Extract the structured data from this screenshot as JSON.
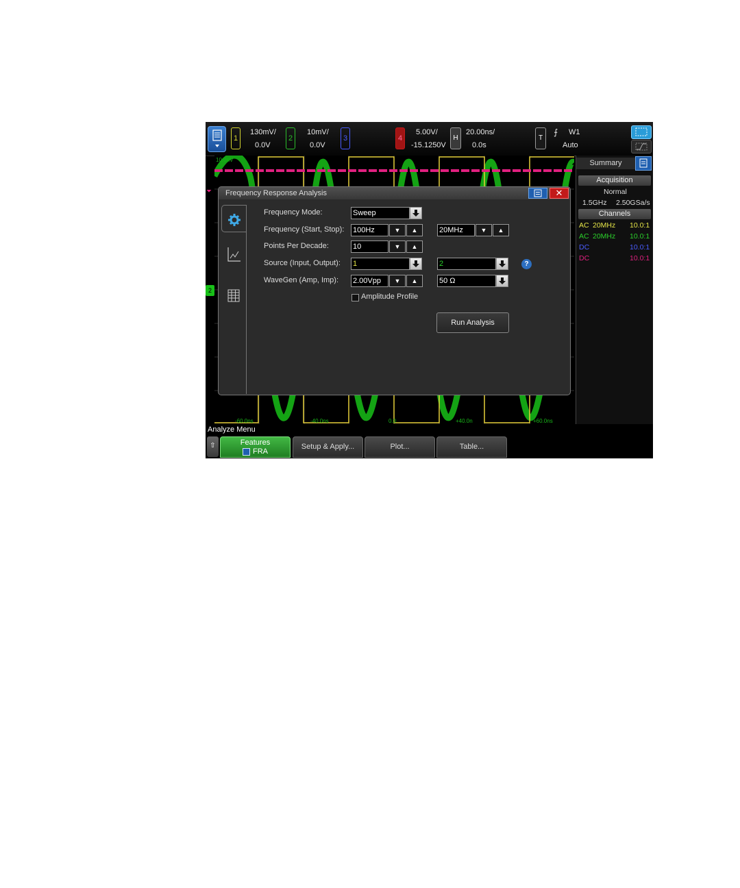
{
  "topbar": {
    "ch1": {
      "label": "1",
      "scale": "130mV/",
      "offset": "0.0V",
      "color": "#d6d630"
    },
    "ch2": {
      "label": "2",
      "scale": "10mV/",
      "offset": "0.0V",
      "color": "#2bbf2b"
    },
    "ch3": {
      "label": "3",
      "color": "#4a5cff"
    },
    "ch4": {
      "label": "4",
      "scale": "5.00V/",
      "offset": "-15.1250V",
      "color": "#e0207f"
    },
    "horizontal": {
      "label": "H",
      "timebase": "20.00ns/",
      "delay": "0.0s"
    },
    "trigger": {
      "label": "T",
      "slope_symbol": "⨍",
      "source": "W1",
      "mode": "Auto"
    }
  },
  "waveform": {
    "scale_label": "10.0nV",
    "time_labels": [
      "-60.0ns",
      "-40.0ns",
      "0.0",
      "+40.0n",
      "+60.0ns"
    ],
    "colors": {
      "yellow": "#e5cf3a",
      "green": "#18c018",
      "magenta": "#e0207f"
    },
    "ground_marker": "2"
  },
  "sidebar": {
    "title": "Summary",
    "acquisition": {
      "header": "Acquisition",
      "mode": "Normal",
      "bandwidth": "1.5GHz",
      "sample_rate": "2.50GSa/s"
    },
    "channels": {
      "header": "Channels",
      "rows": [
        {
          "coupling": "AC",
          "bw": "20MHz",
          "probe": "10.0:1",
          "color": "#e5e548"
        },
        {
          "coupling": "AC",
          "bw": "20MHz",
          "probe": "10.0:1",
          "color": "#2bd02b"
        },
        {
          "coupling": "DC",
          "bw": "",
          "probe": "10.0:1",
          "color": "#4a5cff"
        },
        {
          "coupling": "DC",
          "bw": "",
          "probe": "10.0:1",
          "color": "#e0207f"
        }
      ]
    }
  },
  "dialog": {
    "title": "Frequency Response Analysis",
    "close_symbol": "✕",
    "frequency_mode": {
      "label": "Frequency Mode:",
      "value": "Sweep"
    },
    "frequency": {
      "label": "Frequency (Start, Stop):",
      "start": "100Hz",
      "stop": "20MHz"
    },
    "points": {
      "label": "Points Per Decade:",
      "value": "10"
    },
    "source": {
      "label": "Source (Input, Output):",
      "input": "1",
      "output": "2",
      "input_color": "#e5e548",
      "output_color": "#2bd02b"
    },
    "wavegen": {
      "label": "WaveGen (Amp, Imp):",
      "amplitude": "2.00Vpp",
      "impedance": "50 Ω"
    },
    "amplitude_profile": {
      "label": "Amplitude Profile",
      "checked": false
    },
    "help_symbol": "?",
    "run_button": "Run Analysis"
  },
  "softkeys": {
    "menu_title": "Analyze Menu",
    "back_symbol": "⇧",
    "features": {
      "label": "Features",
      "value": "FRA"
    },
    "setup": "Setup & Apply...",
    "plot": "Plot...",
    "table": "Table..."
  }
}
